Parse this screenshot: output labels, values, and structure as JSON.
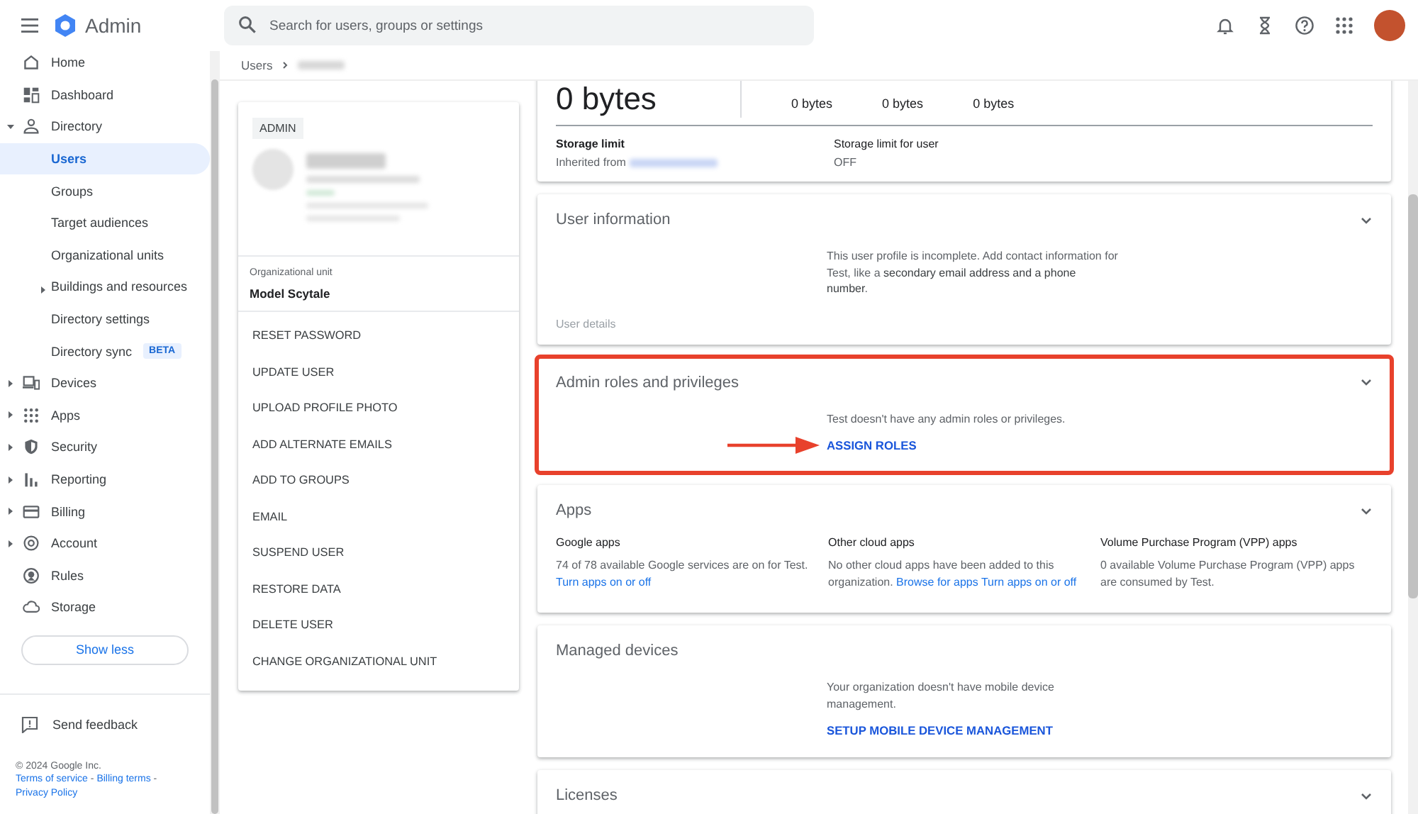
{
  "header": {
    "app_name": "Admin",
    "search": {
      "placeholder": "Search for users, groups or settings"
    }
  },
  "sidebar": {
    "items": [
      {
        "label": "Home",
        "expandable": false,
        "selected": false
      },
      {
        "label": "Dashboard",
        "expandable": false,
        "selected": false
      },
      {
        "label": "Directory",
        "expandable": true,
        "expanded": true,
        "selected": false,
        "children": [
          {
            "label": "Users",
            "expandable": false,
            "selected": true
          },
          {
            "label": "Groups",
            "expandable": false,
            "selected": false
          },
          {
            "label": "Target audiences",
            "expandable": false,
            "selected": false
          },
          {
            "label": "Organizational units",
            "expandable": false,
            "selected": false
          },
          {
            "label": "Buildings and resources",
            "expandable": true,
            "expanded": false,
            "selected": false
          },
          {
            "label": "Directory settings",
            "expandable": false,
            "selected": false
          },
          {
            "label": "Directory sync",
            "badge": "BETA",
            "expandable": false,
            "selected": false
          }
        ]
      },
      {
        "label": "Devices",
        "expandable": true,
        "expanded": false,
        "selected": false
      },
      {
        "label": "Apps",
        "expandable": true,
        "expanded": false,
        "selected": false
      },
      {
        "label": "Security",
        "expandable": true,
        "expanded": false,
        "selected": false
      },
      {
        "label": "Reporting",
        "expandable": true,
        "expanded": false,
        "selected": false
      },
      {
        "label": "Billing",
        "expandable": true,
        "expanded": false,
        "selected": false
      },
      {
        "label": "Account",
        "expandable": true,
        "expanded": false,
        "selected": false
      },
      {
        "label": "Rules",
        "expandable": false,
        "selected": false
      },
      {
        "label": "Storage",
        "expandable": false,
        "selected": false
      }
    ],
    "show_less": "Show less",
    "feedback": "Send feedback",
    "footer": {
      "copyright": "© 2024 Google Inc.",
      "links": [
        "Terms of service",
        "Billing terms",
        "Privacy Policy"
      ],
      "separators": [
        "-",
        "-"
      ]
    }
  },
  "breadcrumb": [
    "Users"
  ],
  "user_card": {
    "role_chip": "ADMIN",
    "org_unit_label": "Organizational unit",
    "org_unit": "Model Scytale",
    "actions": [
      "RESET PASSWORD",
      "UPDATE USER",
      "UPLOAD PROFILE PHOTO",
      "ADD ALTERNATE EMAILS",
      "ADD TO GROUPS",
      "EMAIL",
      "SUSPEND USER",
      "RESTORE DATA",
      "DELETE USER",
      "CHANGE ORGANIZATIONAL UNIT"
    ]
  },
  "sections": [
    {
      "kind": "storage",
      "total": "0 bytes",
      "breakdown": [
        "0 bytes",
        "0 bytes",
        "0 bytes"
      ],
      "limit_label": "Storage limit",
      "limit_source": "Inherited from",
      "user_limit_label": "Storage limit for user",
      "user_limit": "OFF"
    },
    {
      "kind": "message",
      "title": "User information",
      "collapsible": true,
      "highlighted": false,
      "message": "This user profile is incomplete. Add contact information for Test, like a **secondary email address and a phone number**.",
      "footer": "User details"
    },
    {
      "kind": "message",
      "title": "Admin roles and privileges",
      "collapsible": true,
      "highlighted": true,
      "message": "Test doesn't have any admin roles or privileges.",
      "action": "ASSIGN ROLES"
    },
    {
      "kind": "columns",
      "title": "Apps",
      "collapsible": true,
      "highlighted": false,
      "columns": [
        {
          "heading": "Google apps",
          "text": "74 of 78 available Google services are on for Test.",
          "links": [
            "Turn apps on or off"
          ]
        },
        {
          "heading": "Other cloud apps",
          "text": "No other cloud apps have been added to this organization.",
          "links": [
            "Browse for apps",
            "Turn apps on or off"
          ]
        },
        {
          "heading": "Volume Purchase Program (VPP) apps",
          "text": "0 available Volume Purchase Program (VPP) apps are consumed by Test."
        }
      ]
    },
    {
      "kind": "message",
      "title": "Managed devices",
      "collapsible": false,
      "highlighted": false,
      "message": "Your organization doesn't have mobile device management.",
      "action": "SETUP MOBILE DEVICE MANAGEMENT"
    },
    {
      "kind": "message",
      "title": "Licenses",
      "collapsible": true,
      "highlighted": false
    }
  ]
}
